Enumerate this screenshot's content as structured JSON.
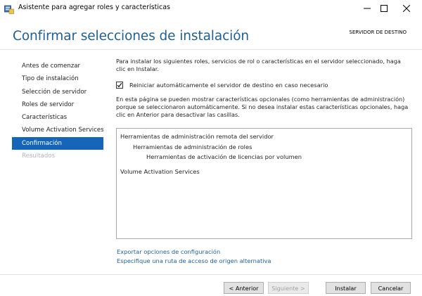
{
  "window": {
    "title": "Asistente para agregar roles y características",
    "minimize_glyph": "minimize-icon",
    "maximize_glyph": "maximize-icon",
    "close_glyph": "close-icon"
  },
  "header": {
    "title": "Confirmar selecciones de instalación",
    "destination_label": "SERVIDOR DE DESTINO"
  },
  "nav": {
    "items": [
      {
        "label": "Antes de comenzar",
        "state": "normal"
      },
      {
        "label": "Tipo de instalación",
        "state": "normal"
      },
      {
        "label": "Selección de servidor",
        "state": "normal"
      },
      {
        "label": "Roles de servidor",
        "state": "normal"
      },
      {
        "label": "Características",
        "state": "normal"
      },
      {
        "label": "Volume Activation Services",
        "state": "normal"
      },
      {
        "label": "Confirmación",
        "state": "active"
      },
      {
        "label": "Resultados",
        "state": "disabled"
      }
    ]
  },
  "content": {
    "intro": "Para instalar los siguientes roles, servicios de rol o características en el servidor seleccionado, haga clic en Instalar.",
    "restart_checkbox_label": "Reiniciar automáticamente el servidor de destino en caso necesario",
    "restart_checked": true,
    "optional_note": "En esta página se pueden mostrar características opcionales (como herramientas de administración) porque se seleccionaron automáticamente. Si no desea instalar estas características opcionales, haga clic en Anterior para desactivar las casillas.",
    "features": [
      {
        "label": "Herramientas de administración remota del servidor",
        "level": 0
      },
      {
        "label": "Herramientas de administración de roles",
        "level": 1
      },
      {
        "label": "Herramientas de activación de licencias por volumen",
        "level": 2
      },
      {
        "label": "Volume Activation Services",
        "level": 0
      }
    ],
    "export_link": "Exportar opciones de configuración",
    "source_path_link": "Especifique una ruta de acceso de origen alternativa"
  },
  "buttons": {
    "previous": "< Anterior",
    "next": "Siguiente >",
    "install": "Instalar",
    "cancel": "Cancelar"
  },
  "colors": {
    "accent": "#1565b8",
    "title_blue": "#1d5f96",
    "disabled_text": "#b5b5b5"
  }
}
